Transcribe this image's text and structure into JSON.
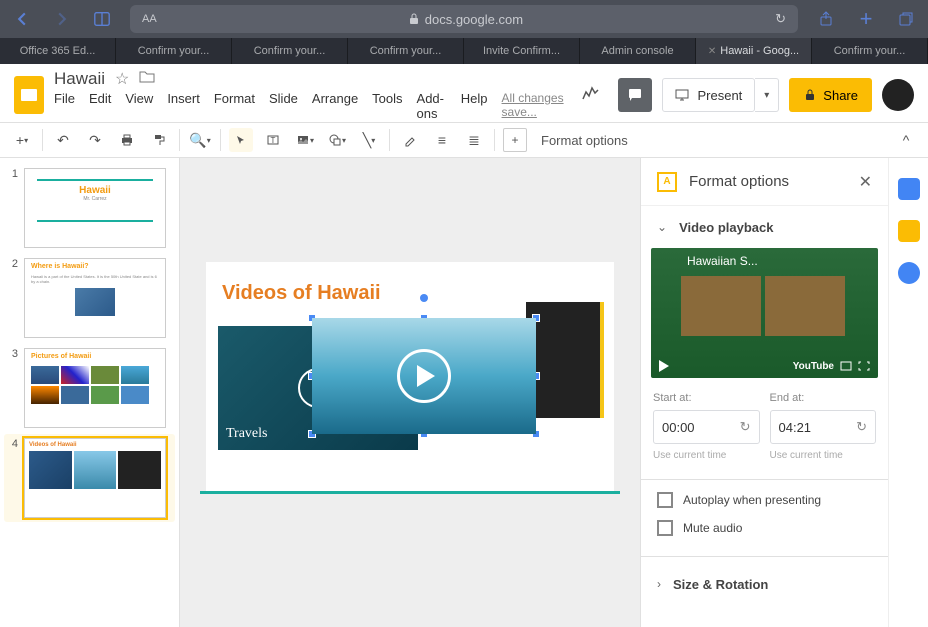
{
  "browser": {
    "url": "docs.google.com",
    "tabs": [
      {
        "label": "Office 365 Ed..."
      },
      {
        "label": "Confirm your..."
      },
      {
        "label": "Confirm your..."
      },
      {
        "label": "Confirm your..."
      },
      {
        "label": "Invite Confirm..."
      },
      {
        "label": "Admin console"
      },
      {
        "label": "Hawaii - Goog...",
        "active": true
      },
      {
        "label": "Confirm your..."
      }
    ]
  },
  "doc": {
    "title": "Hawaii",
    "menus": [
      "File",
      "Edit",
      "View",
      "Insert",
      "Format",
      "Slide",
      "Arrange",
      "Tools",
      "Add-ons",
      "Help"
    ],
    "status": "All changes save...",
    "present": "Present",
    "share": "Share"
  },
  "toolbar": {
    "format_options": "Format options"
  },
  "slides": [
    {
      "n": "1",
      "title": "Hawaii",
      "sub": "Mr. Carrez"
    },
    {
      "n": "2",
      "title": "Where is Hawaii?"
    },
    {
      "n": "3",
      "title": "Pictures of Hawaii"
    },
    {
      "n": "4",
      "title": "Videos of Hawaii",
      "selected": true
    }
  ],
  "canvas": {
    "title": "Videos of Hawaii",
    "travels": "Travels"
  },
  "panel": {
    "title": "Format options",
    "section_video": "Video playback",
    "preview_title": "Hawaiian S...",
    "youtube": "YouTube",
    "start_label": "Start at:",
    "start_value": "00:00",
    "end_label": "End at:",
    "end_value": "04:21",
    "use_current": "Use current time",
    "autoplay": "Autoplay when presenting",
    "mute": "Mute audio",
    "section_size": "Size & Rotation"
  }
}
